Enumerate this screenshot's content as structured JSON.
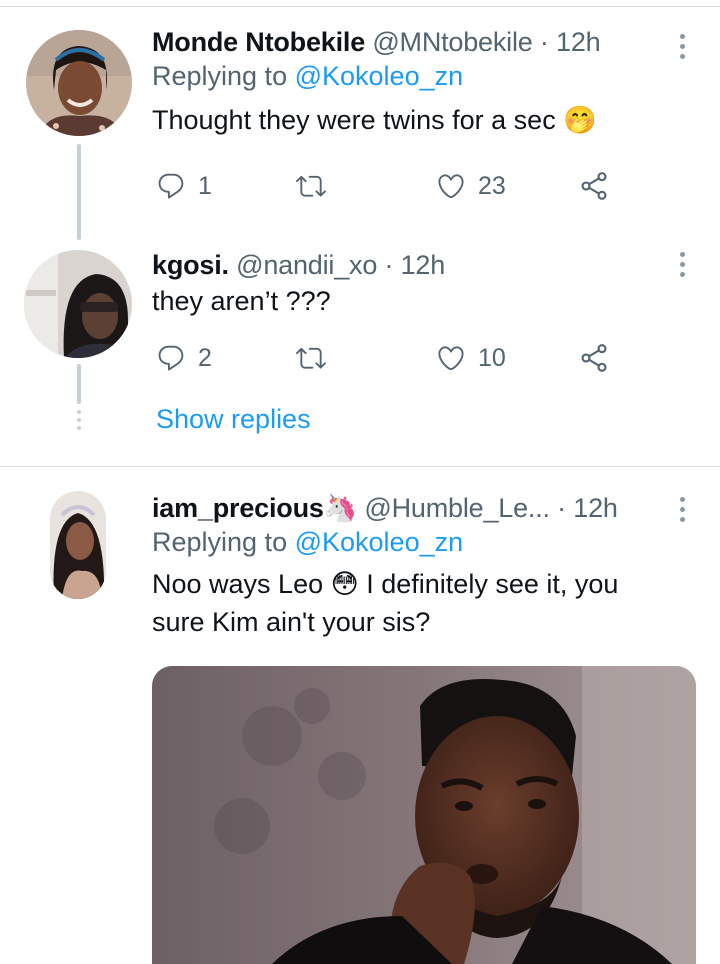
{
  "colors": {
    "link": "#1d9bf0",
    "secondary_text": "#536471",
    "primary_text": "#0f1419",
    "divider": "#d6dbe0",
    "thread_line": "#c4cfd6"
  },
  "tweets": [
    {
      "name": "Monde Ntobekile",
      "handle": "@MNtobekile",
      "separator": "·",
      "time": "12h",
      "replying_prefix": "Replying to",
      "replying_to": "@Kokoleo_zn",
      "text": "Thought they were twins for a sec 🤭",
      "icons": {
        "reply": "reply-icon",
        "retweet": "retweet-icon",
        "like": "heart-icon",
        "share": "share-icon",
        "more": "more-vertical-icon"
      },
      "stats": {
        "replies": "1",
        "retweets": "",
        "likes": "23"
      }
    },
    {
      "name": "kgosi.",
      "handle": "@nandii_xo",
      "separator": "·",
      "time": "12h",
      "text": "they aren’t ???",
      "stats": {
        "replies": "2",
        "retweets": "",
        "likes": "10"
      }
    },
    {
      "name": "iam_precious🦄",
      "handle": "@Humble_Le...",
      "separator": "·",
      "time": "12h",
      "replying_prefix": "Replying to",
      "replying_to": "@Kokoleo_zn",
      "text_line1": "Noo ways Leo 😳 I definitely see it, you",
      "text_line2": "sure Kim ain't your sis?"
    }
  ],
  "thread": {
    "show_replies": "Show replies"
  }
}
